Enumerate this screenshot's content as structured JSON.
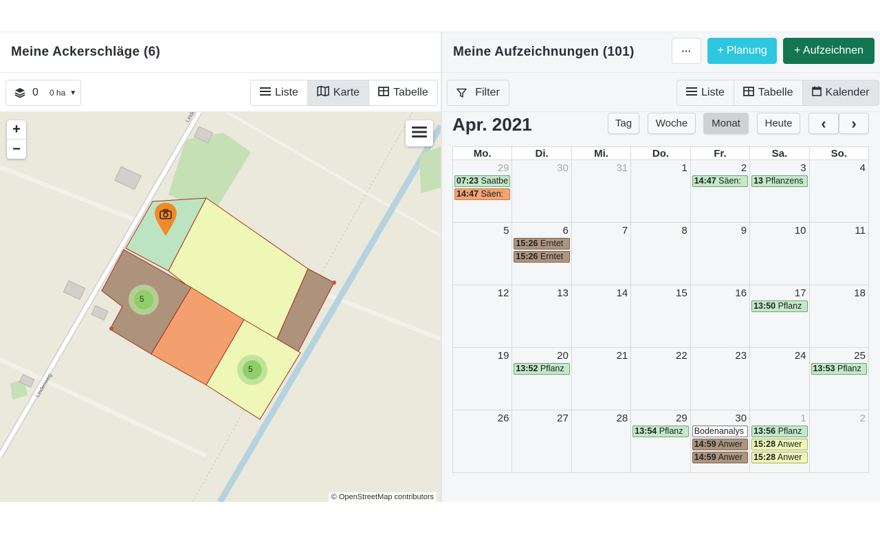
{
  "left": {
    "title": "Meine Ackerschläge (6)",
    "layer_count": "0",
    "area": "0 ha",
    "views": [
      {
        "label": "Liste",
        "icon": "list-icon",
        "active": false
      },
      {
        "label": "Karte",
        "icon": "map-icon",
        "active": true
      },
      {
        "label": "Tabelle",
        "icon": "table-icon",
        "active": false
      }
    ],
    "map": {
      "zoom_in": "+",
      "zoom_out": "−",
      "attribution": "© OpenStreetMap contributors",
      "street_label_1": "Lindenweg",
      "street_label_2": "Lindenweg",
      "cluster_1": "5",
      "cluster_2": "5"
    }
  },
  "right": {
    "title": "Meine Aufzeichnungen (101)",
    "more_label": "···",
    "planung_label": "+ Planung",
    "aufzeichnen_label": "+ Aufzeichnen",
    "filter_label": "Filter",
    "views": [
      {
        "label": "Liste",
        "icon": "list-icon",
        "active": false
      },
      {
        "label": "Tabelle",
        "icon": "table-icon",
        "active": false
      },
      {
        "label": "Kalender",
        "icon": "calendar-icon",
        "active": true
      }
    ],
    "calendar": {
      "month_title": "Apr. 2021",
      "buttons": {
        "tag": "Tag",
        "woche": "Woche",
        "monat": "Monat",
        "heute": "Heute",
        "prev": "‹",
        "next": "›"
      },
      "weekdays": [
        "Mo.",
        "Di.",
        "Mi.",
        "Do.",
        "Fr.",
        "Sa.",
        "So."
      ],
      "weeks": [
        [
          {
            "day": "29",
            "other": true,
            "events": [
              {
                "time": "07:23",
                "text": "Saatbe",
                "color": "green"
              },
              {
                "time": "14:47",
                "text": "Säen:",
                "color": "orange"
              }
            ]
          },
          {
            "day": "30",
            "other": true,
            "events": []
          },
          {
            "day": "31",
            "other": true,
            "events": []
          },
          {
            "day": "1",
            "other": false,
            "events": []
          },
          {
            "day": "2",
            "other": false,
            "events": [
              {
                "time": "14:47",
                "text": "Säen:",
                "color": "green"
              }
            ]
          },
          {
            "day": "3",
            "other": false,
            "events": [
              {
                "time": "13",
                "text": "Pflanzens",
                "color": "green"
              }
            ]
          },
          {
            "day": "4",
            "other": false,
            "events": []
          }
        ],
        [
          {
            "day": "5",
            "other": false,
            "events": []
          },
          {
            "day": "6",
            "other": false,
            "events": [
              {
                "time": "15:26",
                "text": "Erntet",
                "color": "brown"
              },
              {
                "time": "15:26",
                "text": "Erntet",
                "color": "brown"
              }
            ]
          },
          {
            "day": "7",
            "other": false,
            "events": []
          },
          {
            "day": "8",
            "other": false,
            "events": []
          },
          {
            "day": "9",
            "other": false,
            "events": []
          },
          {
            "day": "10",
            "other": false,
            "events": []
          },
          {
            "day": "11",
            "other": false,
            "events": []
          }
        ],
        [
          {
            "day": "12",
            "other": false,
            "events": []
          },
          {
            "day": "13",
            "other": false,
            "events": []
          },
          {
            "day": "14",
            "other": false,
            "events": []
          },
          {
            "day": "15",
            "other": false,
            "events": []
          },
          {
            "day": "16",
            "other": false,
            "events": []
          },
          {
            "day": "17",
            "other": false,
            "events": [
              {
                "time": "13:50",
                "text": "Pflanz",
                "color": "green"
              }
            ]
          },
          {
            "day": "18",
            "other": false,
            "events": []
          }
        ],
        [
          {
            "day": "19",
            "other": false,
            "events": []
          },
          {
            "day": "20",
            "other": false,
            "events": [
              {
                "time": "13:52",
                "text": "Pflanz",
                "color": "green"
              }
            ]
          },
          {
            "day": "21",
            "other": false,
            "events": []
          },
          {
            "day": "22",
            "other": false,
            "events": []
          },
          {
            "day": "23",
            "other": false,
            "events": []
          },
          {
            "day": "24",
            "other": false,
            "events": []
          },
          {
            "day": "25",
            "other": false,
            "events": [
              {
                "time": "13:53",
                "text": "Pflanz",
                "color": "green"
              }
            ]
          }
        ],
        [
          {
            "day": "26",
            "other": false,
            "events": []
          },
          {
            "day": "27",
            "other": false,
            "events": []
          },
          {
            "day": "28",
            "other": false,
            "events": []
          },
          {
            "day": "29",
            "other": false,
            "events": [
              {
                "time": "13:54",
                "text": "Pflanz",
                "color": "green"
              }
            ]
          },
          {
            "day": "30",
            "other": false,
            "events": [
              {
                "time": "",
                "text": "Bodenanalys",
                "color": "white"
              },
              {
                "time": "14:59",
                "text": "Anwer",
                "color": "brown"
              },
              {
                "time": "14:59",
                "text": "Anwer",
                "color": "brown"
              }
            ]
          },
          {
            "day": "1",
            "other": true,
            "events": [
              {
                "time": "13:56",
                "text": "Pflanz",
                "color": "green"
              },
              {
                "time": "15:28",
                "text": "Anwer",
                "color": "yellow"
              },
              {
                "time": "15:28",
                "text": "Anwer",
                "color": "yellow"
              }
            ]
          },
          {
            "day": "2",
            "other": true,
            "events": []
          }
        ]
      ]
    }
  },
  "colors": {
    "planung": "#2ec7df",
    "aufzeichnen": "#147552",
    "field_green": "#bde4c0",
    "field_yellow": "#eef7b6",
    "field_brown": "#ad927c",
    "field_orange": "#f49f6e",
    "marker": "#ef8a2a"
  }
}
